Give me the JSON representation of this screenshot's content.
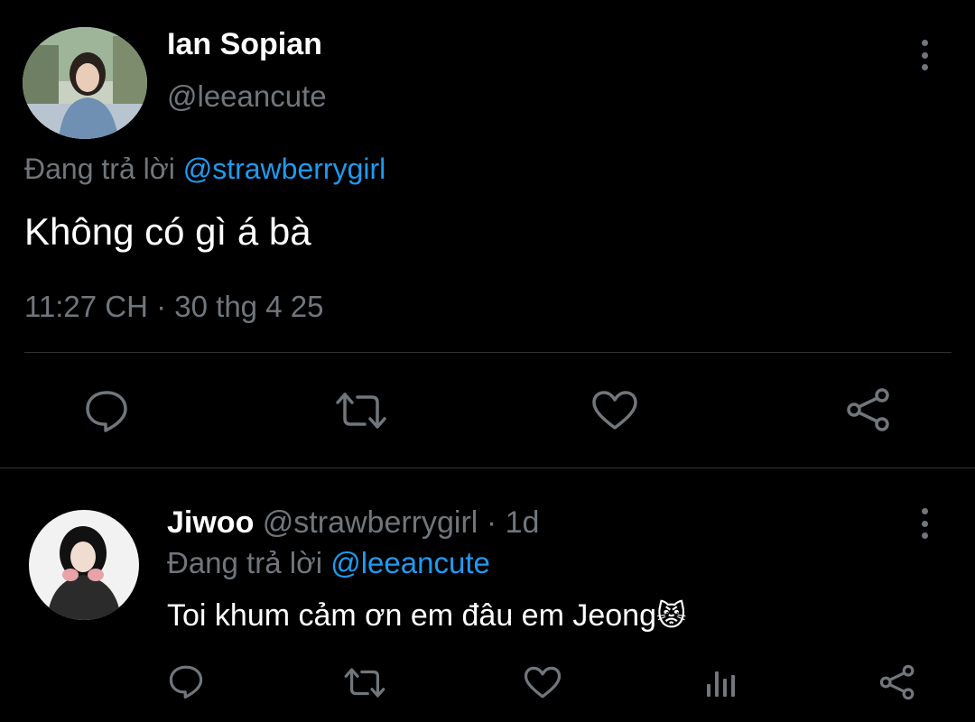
{
  "main_tweet": {
    "author_name": "Ian Sopian",
    "author_handle": "@leeancute",
    "replying_to_prefix": "Đang trả lời",
    "replying_to_handle": "@strawberrygirl",
    "text": "Không có gì á bà",
    "timestamp": "11:27 CH · 30 thg 4 25",
    "actions": {
      "reply_icon": "reply-icon",
      "retweet_icon": "retweet-icon",
      "like_icon": "heart-icon",
      "share_icon": "share-icon"
    }
  },
  "reply_tweet": {
    "author_name": "Jiwoo",
    "author_handle": "@strawberrygirl",
    "time_ago": "· 1d",
    "replying_to_prefix": "Đang trả lời",
    "replying_to_handle": "@leeancute",
    "text": "Toi khum cảm ơn em đâu em Jeong",
    "emoji": "😾",
    "actions": {
      "reply_icon": "reply-icon",
      "retweet_icon": "retweet-icon",
      "like_icon": "heart-icon",
      "views_icon": "views-icon",
      "share_icon": "share-icon"
    }
  },
  "colors": {
    "background": "#000000",
    "text": "#e7e9ea",
    "muted": "#71767b",
    "link": "#1d9bf0",
    "divider": "#2f3336"
  }
}
